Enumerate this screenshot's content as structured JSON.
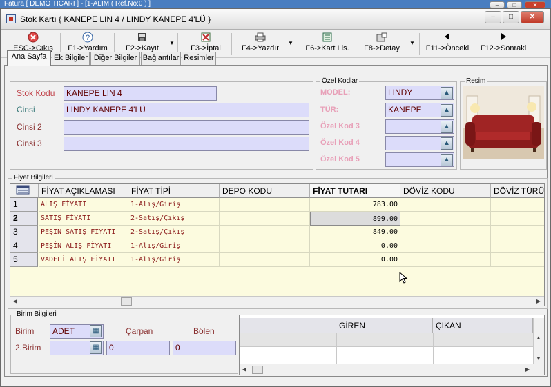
{
  "outer_window": {
    "title": "Fatura [ DEMO TİCARİ ] - [1-ALIM ( Ref.No:0 ) ]"
  },
  "window": {
    "title": "Stok Kartı { KANEPE LIN 4 / LINDY KANEPE 4'LÜ }",
    "controls": {
      "minimize": "–",
      "maximize": "□",
      "close": "✕"
    }
  },
  "toolbar": [
    {
      "icon": "cancel-icon",
      "label": "ESC->Çıkış"
    },
    {
      "icon": "help-icon",
      "label": "F1->Yardım"
    },
    {
      "icon": "save-icon",
      "label": "F2->Kayıt"
    },
    {
      "icon": "cancel-doc-icon",
      "label": "F3->İptal"
    },
    {
      "icon": "printer-icon",
      "label": "F4->Yazdır"
    },
    {
      "icon": "list-icon",
      "label": "F6->Kart Lis."
    },
    {
      "icon": "detail-icon",
      "label": "F8->Detay"
    },
    {
      "icon": "arrow-left-icon",
      "label": "F11->Önceki"
    },
    {
      "icon": "arrow-right-icon",
      "label": "F12->Sonraki"
    }
  ],
  "tabs": [
    "Ana Sayfa",
    "Ek Bilgiler",
    "Diğer Bilgiler",
    "Bağlantılar",
    "Resimler"
  ],
  "main_fields": {
    "stok_kodu": {
      "label": "Stok Kodu",
      "value": "KANEPE LIN 4"
    },
    "cinsi": {
      "label": "Cinsi",
      "value": "LINDY KANEPE 4'LÜ"
    },
    "cinsi2": {
      "label": "Cinsi 2",
      "value": ""
    },
    "cinsi3": {
      "label": "Cinsi 3",
      "value": ""
    }
  },
  "ozel_kodlar": {
    "title": "Özel Kodlar",
    "items": [
      {
        "label": "MODEL:",
        "value": "LINDY"
      },
      {
        "label": "TÜR:",
        "value": "KANEPE"
      },
      {
        "label": "Özel Kod 3",
        "value": ""
      },
      {
        "label": "Özel Kod 4",
        "value": ""
      },
      {
        "label": "Özel Kod 5",
        "value": ""
      }
    ]
  },
  "resim": {
    "title": "Resim"
  },
  "fiyat": {
    "title": "Fiyat Bilgileri",
    "columns": [
      "FİYAT AÇIKLAMASI",
      "FİYAT TİPİ",
      "DEPO KODU",
      "FİYAT TUTARI",
      "DÖVİZ KODU",
      "DÖVİZ TÜRÜ"
    ],
    "rows": [
      {
        "no": "1",
        "aciklama": "ALIŞ FİYATI",
        "tip": "1-Alış/Giriş",
        "depo": "",
        "tutar": "783.00",
        "doviz_kodu": "",
        "doviz_turu": ""
      },
      {
        "no": "2",
        "aciklama": "SATIŞ FİYATI",
        "tip": "2-Satış/Çıkış",
        "depo": "",
        "tutar": "899.00",
        "doviz_kodu": "",
        "doviz_turu": ""
      },
      {
        "no": "3",
        "aciklama": "PEŞİN SATIŞ FİYATI",
        "tip": "2-Satış/Çıkış",
        "depo": "",
        "tutar": "849.00",
        "doviz_kodu": "",
        "doviz_turu": ""
      },
      {
        "no": "4",
        "aciklama": "PEŞİN ALIŞ FİYATI",
        "tip": "1-Alış/Giriş",
        "depo": "",
        "tutar": "0.00",
        "doviz_kodu": "",
        "doviz_turu": ""
      },
      {
        "no": "5",
        "aciklama": "VADELİ ALIŞ FİYATI",
        "tip": "1-Alış/Giriş",
        "depo": "",
        "tutar": "0.00",
        "doviz_kodu": "",
        "doviz_turu": ""
      }
    ]
  },
  "birim": {
    "title": "Birim Bilgileri",
    "birim_label": "Birim",
    "birim_value": "ADET",
    "carpan_label": "Çarpan",
    "bolen_label": "Bölen",
    "birim2_label": "2.Birim",
    "birim2_value": "",
    "carpan_value": "0",
    "bolen_value": "0"
  },
  "hareket": {
    "columns": [
      "",
      "GİREN",
      "ÇIKAN"
    ]
  },
  "colors": {
    "label_red": "#c04048",
    "pink": "#e8a0b8",
    "input_bg": "#dcdcfa",
    "grid_bg": "#fcfbdf"
  }
}
